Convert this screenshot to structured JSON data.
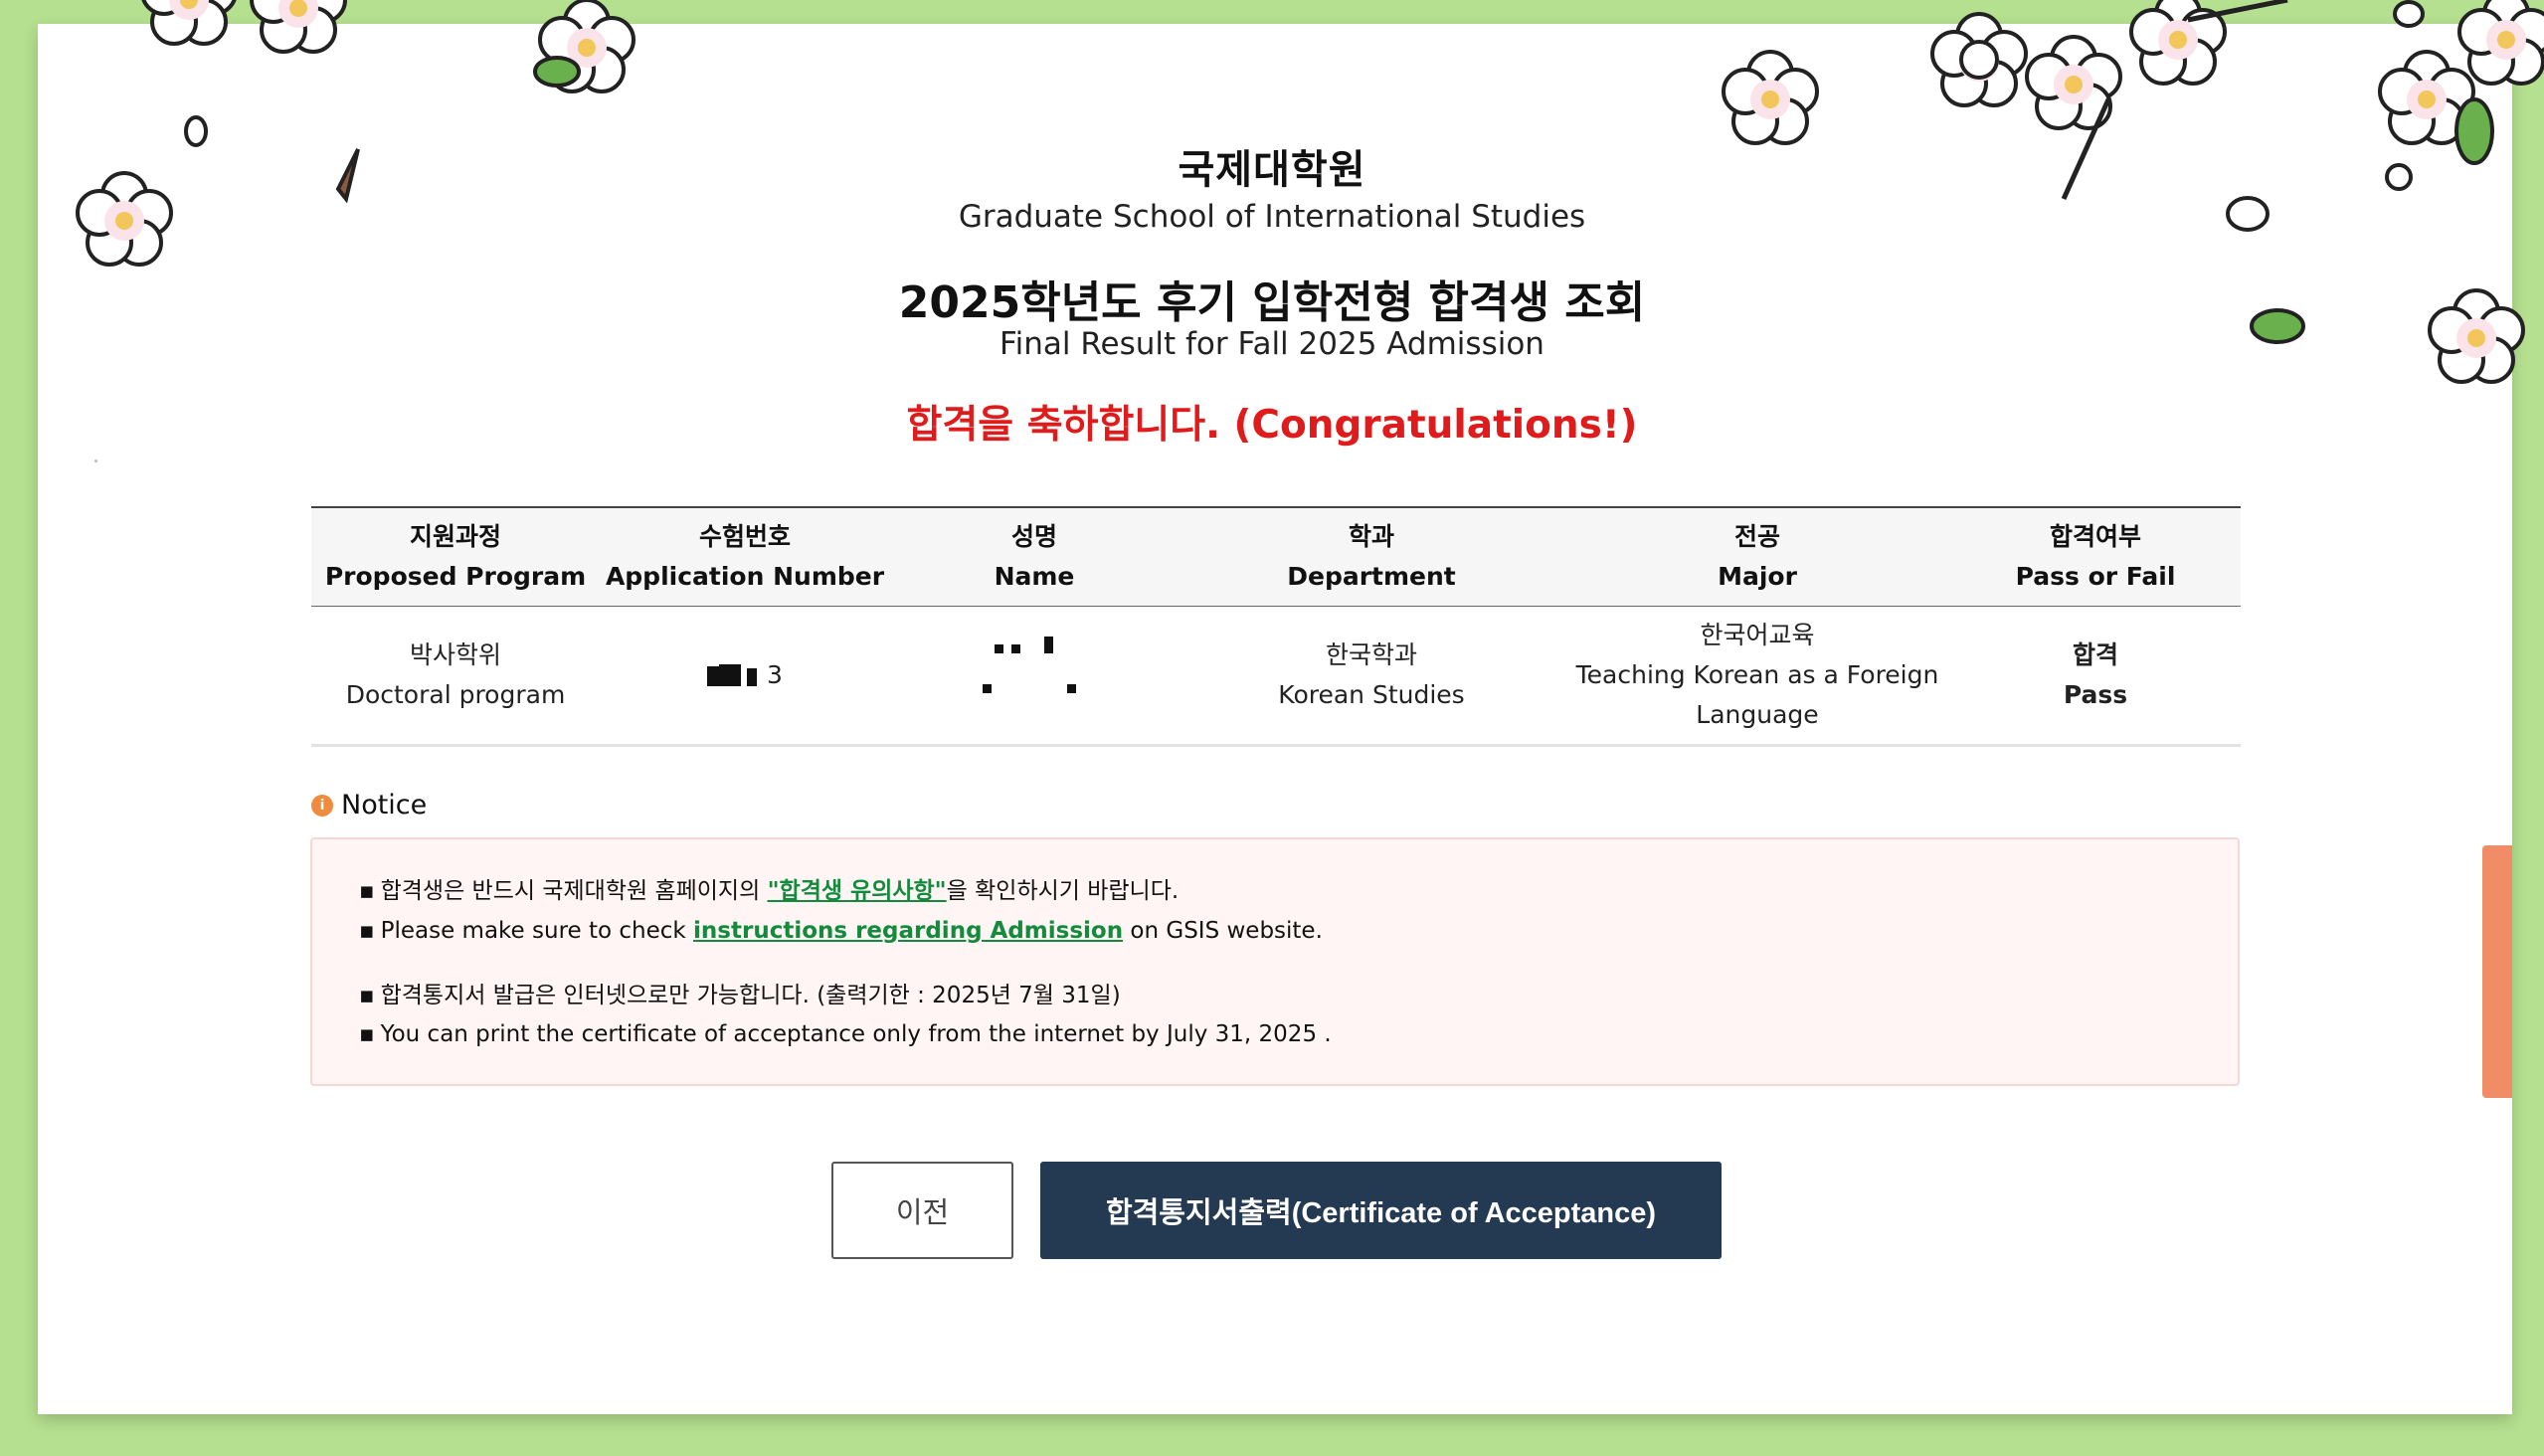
{
  "header": {
    "school_ko": "국제대학원",
    "school_en": "Graduate School of International Studies",
    "title_ko": "2025학년도 후기 입학전형 합격생 조회",
    "title_en": "Final Result for Fall 2025 Admission",
    "congrats": "합격을 축하합니다. (Congratulations!)"
  },
  "table": {
    "headers": [
      {
        "ko": "지원과정",
        "en": "Proposed Program"
      },
      {
        "ko": "수험번호",
        "en": "Application Number"
      },
      {
        "ko": "성명",
        "en": "Name"
      },
      {
        "ko": "학과",
        "en": "Department"
      },
      {
        "ko": "전공",
        "en": "Major"
      },
      {
        "ko": "합격여부",
        "en": "Pass or Fail"
      }
    ],
    "row": {
      "program_ko": "박사학위",
      "program_en": "Doctoral program",
      "application_suffix": "3",
      "department_ko": "한국학과",
      "department_en": "Korean Studies",
      "major_ko": "한국어교육",
      "major_en_line1": "Teaching Korean as a Foreign",
      "major_en_line2": "Language",
      "result_ko": "합격",
      "result_en": "Pass"
    }
  },
  "notice": {
    "title": "Notice",
    "icon": "info-icon",
    "line1_prefix": "합격생은 반드시 국제대학원 홈페이지의 ",
    "line1_link": "\"합격생 유의사항\"",
    "line1_suffix": "을 확인하시기 바랍니다.",
    "line2_prefix": "Please make sure to check ",
    "line2_link": "instructions regarding Admission",
    "line2_suffix": " on GSIS website.",
    "line3": "합격통지서 발급은 인터넷으로만 가능합니다. (출력기한 : 2025년 7월 31일)",
    "line4": "You can print the certificate of acceptance only from the internet by July 31, 2025 .",
    "bullet": "▪"
  },
  "buttons": {
    "prev": "이전",
    "certificate": "합격통지서출력(Certificate of Acceptance)"
  },
  "colors": {
    "background": "#b5e08f",
    "congrats": "#e01b1b",
    "link": "#138a3c",
    "primary_button": "#243a52",
    "notice_bg": "#fff5f4",
    "side_tab": "#f08c66"
  }
}
